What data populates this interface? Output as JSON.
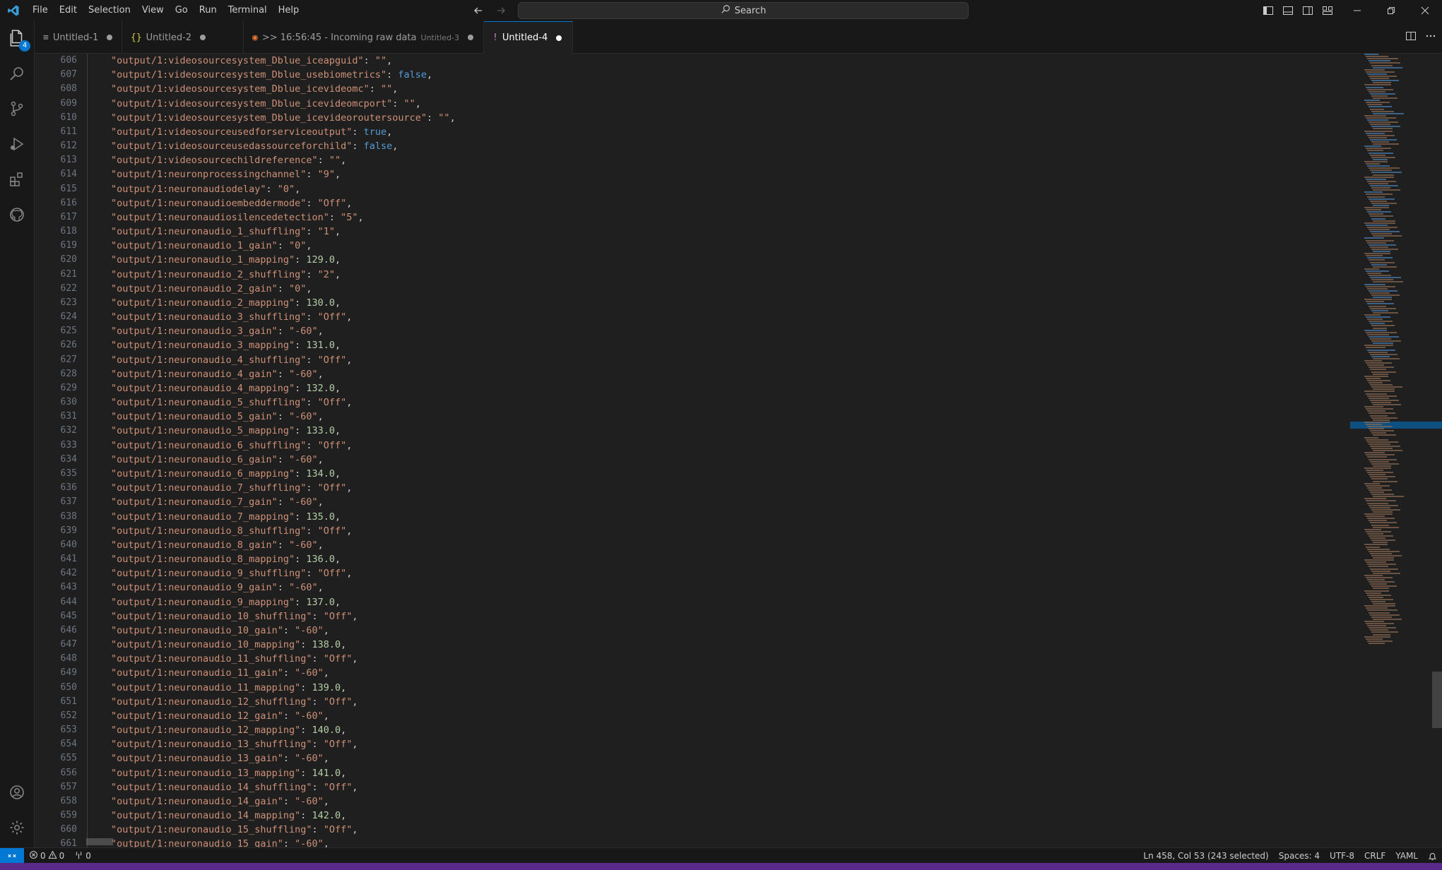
{
  "menu": [
    "File",
    "Edit",
    "Selection",
    "View",
    "Go",
    "Run",
    "Terminal",
    "Help"
  ],
  "search": {
    "label": "Search"
  },
  "explorer_badge": "4",
  "tabs": [
    {
      "icon": "≡",
      "label": "Untitled-1",
      "description": ""
    },
    {
      "icon": "{}",
      "label": "Untitled-2",
      "description": ""
    },
    {
      "icon": "◉",
      "label": ">> 16:56:45 - Incoming raw data",
      "description": "Untitled-3"
    },
    {
      "icon": "!",
      "label": "Untitled-4",
      "description": ""
    }
  ],
  "colors": {
    "accent": "#0078d4",
    "string": "#ce9178",
    "boolean": "#569cd6",
    "number": "#b5cea8"
  },
  "lines": [
    {
      "n": "606",
      "k": "\"output/1:videosourcesystem_Dblue_iceapguid\"",
      "v": "\"\"",
      "t": "s"
    },
    {
      "n": "607",
      "k": "\"output/1:videosourcesystem_Dblue_usebiometrics\"",
      "v": "false",
      "t": "b"
    },
    {
      "n": "608",
      "k": "\"output/1:videosourcesystem_Dblue_icevideomc\"",
      "v": "\"\"",
      "t": "s"
    },
    {
      "n": "609",
      "k": "\"output/1:videosourcesystem_Dblue_icevideomcport\"",
      "v": "\"\"",
      "t": "s"
    },
    {
      "n": "610",
      "k": "\"output/1:videosourcesystem_Dblue_icevideoroutersource\"",
      "v": "\"\"",
      "t": "s"
    },
    {
      "n": "611",
      "k": "\"output/1:videosourceusedforserviceoutput\"",
      "v": "true",
      "t": "b"
    },
    {
      "n": "612",
      "k": "\"output/1:videosourceusedassourceforchild\"",
      "v": "false",
      "t": "b"
    },
    {
      "n": "613",
      "k": "\"output/1:videosourcechildreference\"",
      "v": "\"\"",
      "t": "s"
    },
    {
      "n": "614",
      "k": "\"output/1:neuronprocessingchannel\"",
      "v": "\"9\"",
      "t": "s"
    },
    {
      "n": "615",
      "k": "\"output/1:neuronaudiodelay\"",
      "v": "\"0\"",
      "t": "s"
    },
    {
      "n": "616",
      "k": "\"output/1:neuronaudioembeddermode\"",
      "v": "\"Off\"",
      "t": "s"
    },
    {
      "n": "617",
      "k": "\"output/1:neuronaudiosilencedetection\"",
      "v": "\"5\"",
      "t": "s"
    },
    {
      "n": "618",
      "k": "\"output/1:neuronaudio_1_shuffling\"",
      "v": "\"1\"",
      "t": "s"
    },
    {
      "n": "619",
      "k": "\"output/1:neuronaudio_1_gain\"",
      "v": "\"0\"",
      "t": "s"
    },
    {
      "n": "620",
      "k": "\"output/1:neuronaudio_1_mapping\"",
      "v": "129.0",
      "t": "n"
    },
    {
      "n": "621",
      "k": "\"output/1:neuronaudio_2_shuffling\"",
      "v": "\"2\"",
      "t": "s"
    },
    {
      "n": "622",
      "k": "\"output/1:neuronaudio_2_gain\"",
      "v": "\"0\"",
      "t": "s"
    },
    {
      "n": "623",
      "k": "\"output/1:neuronaudio_2_mapping\"",
      "v": "130.0",
      "t": "n"
    },
    {
      "n": "624",
      "k": "\"output/1:neuronaudio_3_shuffling\"",
      "v": "\"Off\"",
      "t": "s"
    },
    {
      "n": "625",
      "k": "\"output/1:neuronaudio_3_gain\"",
      "v": "\"-60\"",
      "t": "s"
    },
    {
      "n": "626",
      "k": "\"output/1:neuronaudio_3_mapping\"",
      "v": "131.0",
      "t": "n"
    },
    {
      "n": "627",
      "k": "\"output/1:neuronaudio_4_shuffling\"",
      "v": "\"Off\"",
      "t": "s"
    },
    {
      "n": "628",
      "k": "\"output/1:neuronaudio_4_gain\"",
      "v": "\"-60\"",
      "t": "s"
    },
    {
      "n": "629",
      "k": "\"output/1:neuronaudio_4_mapping\"",
      "v": "132.0",
      "t": "n"
    },
    {
      "n": "630",
      "k": "\"output/1:neuronaudio_5_shuffling\"",
      "v": "\"Off\"",
      "t": "s"
    },
    {
      "n": "631",
      "k": "\"output/1:neuronaudio_5_gain\"",
      "v": "\"-60\"",
      "t": "s"
    },
    {
      "n": "632",
      "k": "\"output/1:neuronaudio_5_mapping\"",
      "v": "133.0",
      "t": "n"
    },
    {
      "n": "633",
      "k": "\"output/1:neuronaudio_6_shuffling\"",
      "v": "\"Off\"",
      "t": "s"
    },
    {
      "n": "634",
      "k": "\"output/1:neuronaudio_6_gain\"",
      "v": "\"-60\"",
      "t": "s"
    },
    {
      "n": "635",
      "k": "\"output/1:neuronaudio_6_mapping\"",
      "v": "134.0",
      "t": "n"
    },
    {
      "n": "636",
      "k": "\"output/1:neuronaudio_7_shuffling\"",
      "v": "\"Off\"",
      "t": "s"
    },
    {
      "n": "637",
      "k": "\"output/1:neuronaudio_7_gain\"",
      "v": "\"-60\"",
      "t": "s"
    },
    {
      "n": "638",
      "k": "\"output/1:neuronaudio_7_mapping\"",
      "v": "135.0",
      "t": "n"
    },
    {
      "n": "639",
      "k": "\"output/1:neuronaudio_8_shuffling\"",
      "v": "\"Off\"",
      "t": "s"
    },
    {
      "n": "640",
      "k": "\"output/1:neuronaudio_8_gain\"",
      "v": "\"-60\"",
      "t": "s"
    },
    {
      "n": "641",
      "k": "\"output/1:neuronaudio_8_mapping\"",
      "v": "136.0",
      "t": "n"
    },
    {
      "n": "642",
      "k": "\"output/1:neuronaudio_9_shuffling\"",
      "v": "\"Off\"",
      "t": "s"
    },
    {
      "n": "643",
      "k": "\"output/1:neuronaudio_9_gain\"",
      "v": "\"-60\"",
      "t": "s"
    },
    {
      "n": "644",
      "k": "\"output/1:neuronaudio_9_mapping\"",
      "v": "137.0",
      "t": "n"
    },
    {
      "n": "645",
      "k": "\"output/1:neuronaudio_10_shuffling\"",
      "v": "\"Off\"",
      "t": "s"
    },
    {
      "n": "646",
      "k": "\"output/1:neuronaudio_10_gain\"",
      "v": "\"-60\"",
      "t": "s"
    },
    {
      "n": "647",
      "k": "\"output/1:neuronaudio_10_mapping\"",
      "v": "138.0",
      "t": "n"
    },
    {
      "n": "648",
      "k": "\"output/1:neuronaudio_11_shuffling\"",
      "v": "\"Off\"",
      "t": "s"
    },
    {
      "n": "649",
      "k": "\"output/1:neuronaudio_11_gain\"",
      "v": "\"-60\"",
      "t": "s"
    },
    {
      "n": "650",
      "k": "\"output/1:neuronaudio_11_mapping\"",
      "v": "139.0",
      "t": "n"
    },
    {
      "n": "651",
      "k": "\"output/1:neuronaudio_12_shuffling\"",
      "v": "\"Off\"",
      "t": "s"
    },
    {
      "n": "652",
      "k": "\"output/1:neuronaudio_12_gain\"",
      "v": "\"-60\"",
      "t": "s"
    },
    {
      "n": "653",
      "k": "\"output/1:neuronaudio_12_mapping\"",
      "v": "140.0",
      "t": "n"
    },
    {
      "n": "654",
      "k": "\"output/1:neuronaudio_13_shuffling\"",
      "v": "\"Off\"",
      "t": "s"
    },
    {
      "n": "655",
      "k": "\"output/1:neuronaudio_13_gain\"",
      "v": "\"-60\"",
      "t": "s"
    },
    {
      "n": "656",
      "k": "\"output/1:neuronaudio_13_mapping\"",
      "v": "141.0",
      "t": "n"
    },
    {
      "n": "657",
      "k": "\"output/1:neuronaudio_14_shuffling\"",
      "v": "\"Off\"",
      "t": "s"
    },
    {
      "n": "658",
      "k": "\"output/1:neuronaudio_14_gain\"",
      "v": "\"-60\"",
      "t": "s"
    },
    {
      "n": "659",
      "k": "\"output/1:neuronaudio_14_mapping\"",
      "v": "142.0",
      "t": "n"
    },
    {
      "n": "660",
      "k": "\"output/1:neuronaudio_15_shuffling\"",
      "v": "\"Off\"",
      "t": "s"
    },
    {
      "n": "661",
      "k": "\"output/1:neuronaudio_15_gain\"",
      "v": "\"-60\"",
      "t": "s"
    }
  ],
  "status": {
    "errors": "0",
    "warnings": "0",
    "ports": "0",
    "cursor": "Ln 458, Col 53 (243 selected)",
    "spaces": "Spaces: 4",
    "encoding": "UTF-8",
    "eol": "CRLF",
    "language": "YAML"
  }
}
